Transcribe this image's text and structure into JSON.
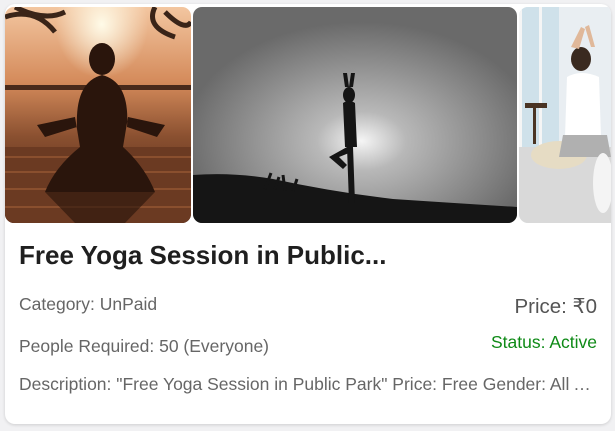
{
  "event": {
    "title": "Free Yoga Session in Public...",
    "category": "Category: UnPaid",
    "price": "Price: ₹0",
    "people_required": "People Required: 50 (Everyone)",
    "status": "Status: Active",
    "description": "Description: \"Free Yoga Session in Public Park\" Price: Free Gender: All Age: All"
  },
  "colors": {
    "status_active": "#0e8a16",
    "title": "#1f1f1f",
    "meta_text": "#666666"
  }
}
